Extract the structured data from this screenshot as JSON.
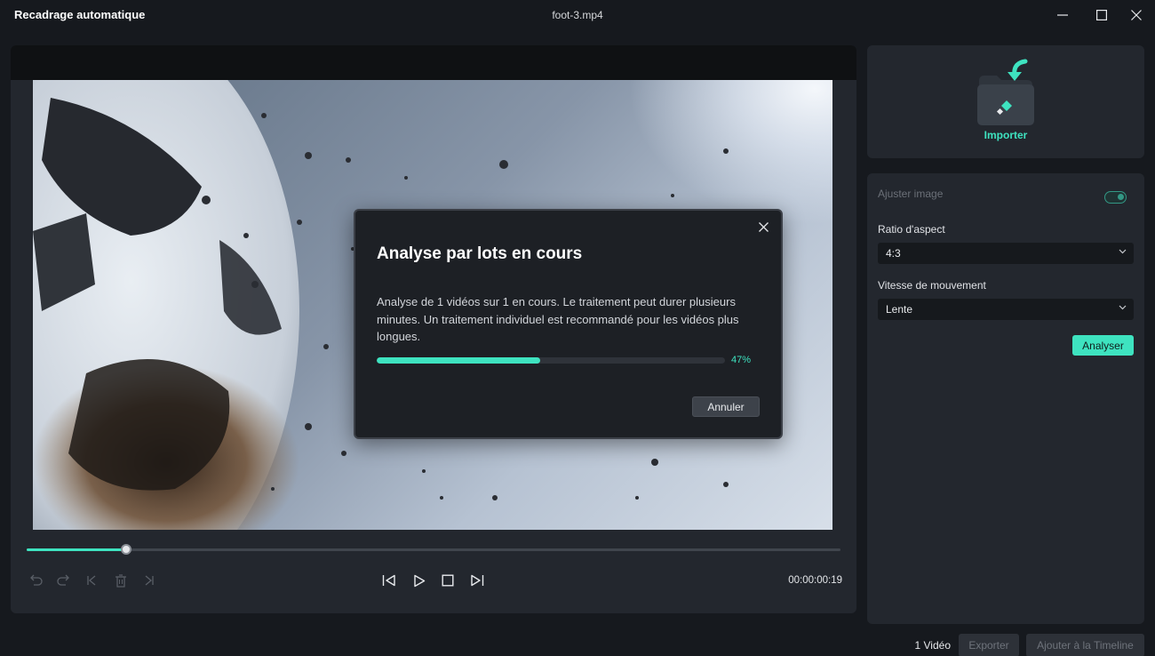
{
  "window": {
    "title": "Recadrage automatique",
    "file_name": "foot-3.mp4"
  },
  "dialog": {
    "title": "Analyse par lots en cours",
    "message": "Analyse de 1 vidéos sur 1 en cours. Le traitement peut durer plusieurs minutes. Un traitement individuel est recommandé pour les vidéos plus longues.",
    "progress_percent": 47,
    "progress_label": "47%",
    "cancel_label": "Annuler"
  },
  "player": {
    "playhead_fraction": 0.122,
    "timecode": "00:00:00:19"
  },
  "sidebar": {
    "import_label": "Importer",
    "adjust_image_label": "Ajuster image",
    "adjust_image_enabled": true,
    "aspect_ratio_label": "Ratio d'aspect",
    "aspect_ratio_value": "4:3",
    "motion_speed_label": "Vitesse de mouvement",
    "motion_speed_value": "Lente",
    "analyze_label": "Analyser"
  },
  "footer": {
    "video_count": "1 Vidéo",
    "export_label": "Exporter",
    "add_timeline_label": "Ajouter à la Timeline"
  },
  "colors": {
    "accent": "#3ee3c0",
    "background": "#16191e",
    "panel": "#23272e"
  }
}
